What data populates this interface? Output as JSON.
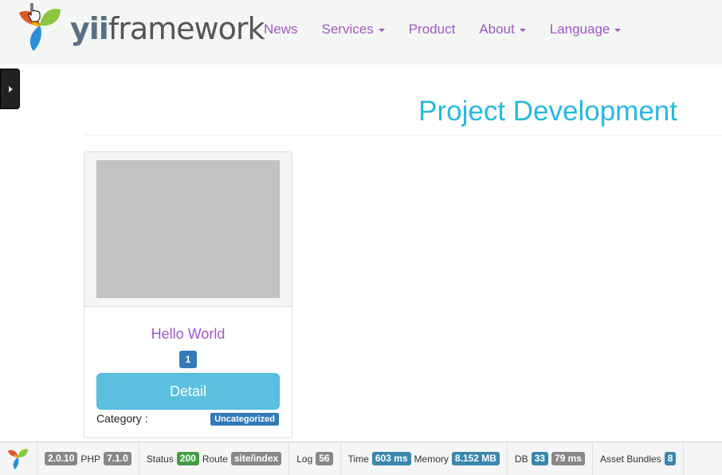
{
  "brand": {
    "prefix": "yii",
    "suffix": "framework"
  },
  "nav": {
    "items": [
      {
        "label": "News",
        "dropdown": false
      },
      {
        "label": "Services",
        "dropdown": true
      },
      {
        "label": "Product",
        "dropdown": false
      },
      {
        "label": "About",
        "dropdown": true
      },
      {
        "label": "Language",
        "dropdown": true
      }
    ]
  },
  "page": {
    "title": "Project Development"
  },
  "card": {
    "title": "Hello World",
    "count": "1",
    "button_label": "Detail",
    "category_label": "Category :",
    "category_value": "Uncategorized"
  },
  "debug": {
    "yii_version": "2.0.10",
    "php_label": "PHP",
    "php_version": "7.1.0",
    "status_label": "Status",
    "status_value": "200",
    "route_label": "Route",
    "route_value": "site/index",
    "log_label": "Log",
    "log_value": "56",
    "time_label": "Time",
    "time_value": "603 ms",
    "memory_label": "Memory",
    "memory_value": "8.152 MB",
    "db_label": "DB",
    "db_queries": "33",
    "db_time": "79 ms",
    "assets_label": "Asset Bundles",
    "assets_value": "8"
  },
  "colors": {
    "link": "#a259c6",
    "title": "#28b8e0",
    "primary": "#337ab7",
    "info_button": "#5bc0de"
  }
}
